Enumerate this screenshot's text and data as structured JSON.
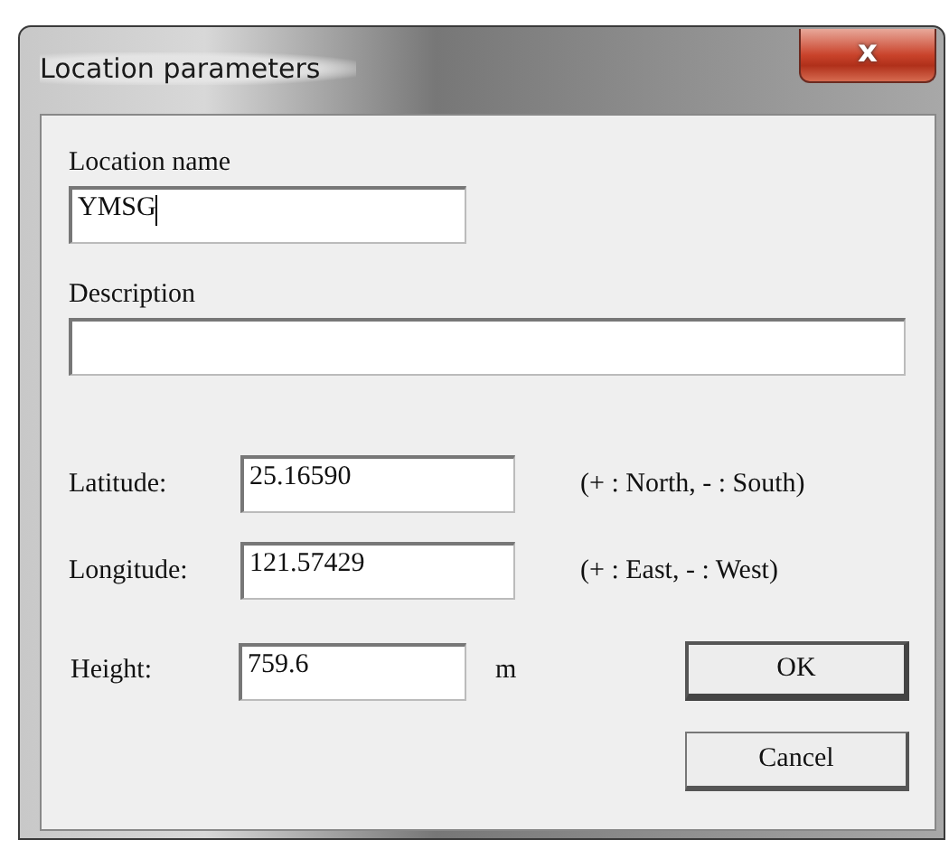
{
  "window": {
    "title": "Location parameters",
    "close": "x"
  },
  "location_name": {
    "label": "Location name",
    "value": "YMSG",
    "focused": true
  },
  "description": {
    "label": "Description"
  },
  "coordinates": [
    {
      "label": "Latitude:",
      "value": "25.16590",
      "hint": "(+ : North, - : South)"
    },
    {
      "label": "Longitude:",
      "value": "121.57429",
      "hint": "(+ : East, - : West)"
    }
  ],
  "height": {
    "label": "Height:",
    "value": "759.6",
    "unit": "m"
  },
  "buttons": [
    {
      "label": "OK",
      "kind": "default"
    },
    {
      "label": "Cancel",
      "kind": "normal"
    }
  ]
}
